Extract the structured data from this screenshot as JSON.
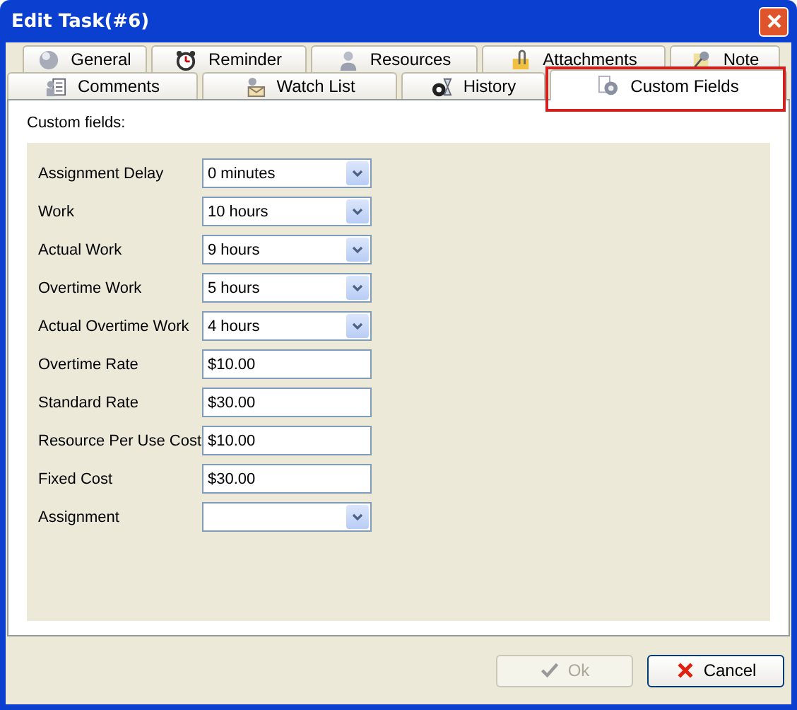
{
  "window": {
    "title": "Edit Task(#6)"
  },
  "tab_rows": [
    [
      {
        "label": "General",
        "selected": false
      },
      {
        "label": "Reminder",
        "selected": false
      },
      {
        "label": "Resources",
        "selected": false
      },
      {
        "label": "Attachments",
        "selected": false
      },
      {
        "label": "Note",
        "selected": false
      }
    ],
    [
      {
        "label": "Comments",
        "selected": false
      },
      {
        "label": "Watch List",
        "selected": false
      },
      {
        "label": "History",
        "selected": false
      },
      {
        "label": "Custom Fields",
        "selected": true,
        "highlighted": true
      }
    ]
  ],
  "section_label": "Custom fields:",
  "fields": [
    {
      "label": "Assignment Delay",
      "kind": "combo",
      "value": "0 minutes"
    },
    {
      "label": "Work",
      "kind": "combo",
      "value": "10 hours"
    },
    {
      "label": "Actual Work",
      "kind": "combo",
      "value": "9 hours"
    },
    {
      "label": "Overtime Work",
      "kind": "combo",
      "value": "5 hours"
    },
    {
      "label": "Actual Overtime Work",
      "kind": "combo",
      "value": "4 hours"
    },
    {
      "label": "Overtime Rate",
      "kind": "text",
      "value": "$10.00"
    },
    {
      "label": "Standard Rate",
      "kind": "text",
      "value": "$30.00"
    },
    {
      "label": "Resource Per Use Cost",
      "kind": "text",
      "value": "$10.00"
    },
    {
      "label": "Fixed Cost",
      "kind": "text",
      "value": "$30.00"
    },
    {
      "label": "Assignment",
      "kind": "combo"
    }
  ],
  "buttons": [
    {
      "label": "Ok",
      "disabled": true
    },
    {
      "label": "Cancel",
      "disabled": false
    }
  ]
}
